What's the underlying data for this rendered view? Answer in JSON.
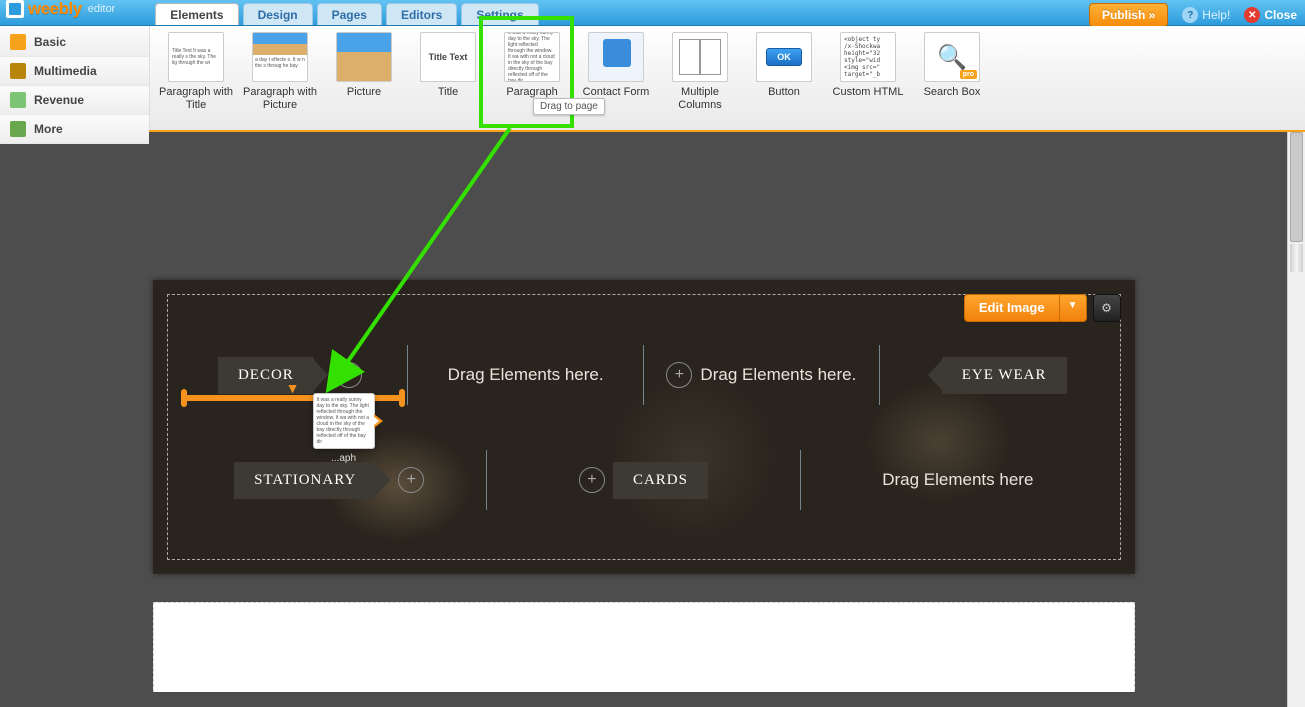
{
  "app": {
    "brand": "weebly",
    "suffix": "editor"
  },
  "tabs": [
    "Elements",
    "Design",
    "Pages",
    "Editors",
    "Settings"
  ],
  "active_tab": "Elements",
  "top_actions": {
    "publish": "Publish »",
    "help": "Help!",
    "close": "Close"
  },
  "side_cats": [
    {
      "label": "Basic",
      "cls": "sc-basic"
    },
    {
      "label": "Multimedia",
      "cls": "sc-multimedia"
    },
    {
      "label": "Revenue",
      "cls": "sc-revenue"
    },
    {
      "label": "More",
      "cls": "sc-more"
    }
  ],
  "tools": [
    {
      "label": "Paragraph with Title",
      "thumb": "para",
      "seed": "Title Text\nIt was a really s the sky. The lig through the wi"
    },
    {
      "label": "Paragraph with Picture",
      "thumb": "picpara"
    },
    {
      "label": "Picture",
      "thumb": "pic"
    },
    {
      "label": "Title",
      "thumb": "txt",
      "seed": "Title Text"
    },
    {
      "label": "Paragraph",
      "thumb": "para",
      "seed": "It was a really sunny day to the sky. The light reflected through the window. It wa with not a cloud in the sky of the bay directly through reflected off of the bay dir"
    },
    {
      "label": "Contact Form",
      "thumb": "form"
    },
    {
      "label": "Multiple Columns",
      "thumb": "cols"
    },
    {
      "label": "Button",
      "thumb": "btn-t"
    },
    {
      "label": "Custom HTML",
      "thumb": "code",
      "seed": "<object ty /x-Shockwa height=\"32 style=\"wid <img src=\" target=\"_b"
    },
    {
      "label": "Search Box",
      "thumb": "search"
    }
  ],
  "drag_tooltip": "Drag to page",
  "hero": {
    "edit_label": "Edit Image",
    "row1": [
      {
        "type": "pill",
        "text": "DECOR",
        "tail": "r",
        "plus": true
      },
      {
        "type": "ph",
        "text": "Drag Elements here."
      },
      {
        "type": "ph",
        "text": "Drag Elements here.",
        "plus_left": true
      },
      {
        "type": "pill",
        "text": "EYE WEAR",
        "tail": "l"
      }
    ],
    "row2": [
      {
        "type": "pill",
        "text": "STATIONARY",
        "tail": "r",
        "plus": true
      },
      {
        "type": "pill",
        "text": "CARDS",
        "plus_left": true
      },
      {
        "type": "ph",
        "text": "Drag Elements here"
      }
    ]
  },
  "ghost_text": "It was a really sunny day to the sky. The light reflected through the window. It wa with not a cloud in the sky of the bay directly through reflected off of the bay dir",
  "ghost_label": "...aph"
}
